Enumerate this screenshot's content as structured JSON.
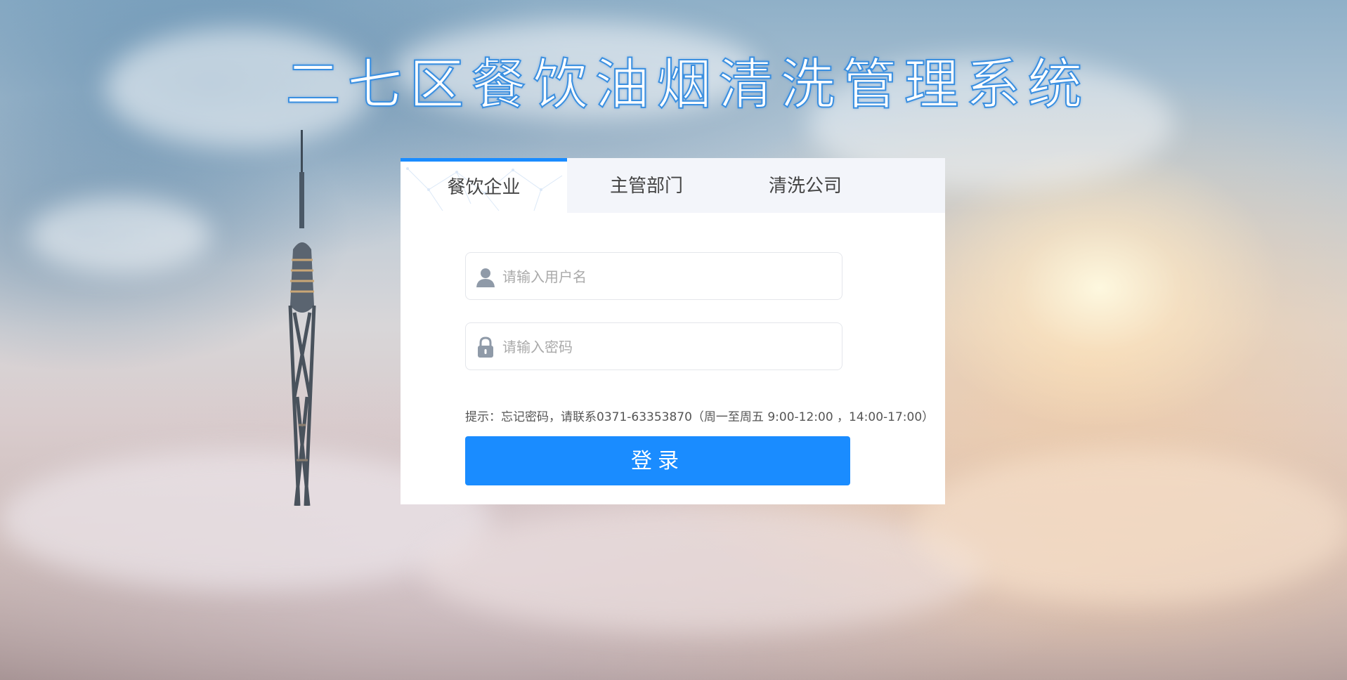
{
  "page": {
    "title": "二七区餐饮油烟清洗管理系统"
  },
  "tabs": [
    {
      "label": "餐饮企业",
      "active": true
    },
    {
      "label": "主管部门",
      "active": false
    },
    {
      "label": "清洗公司",
      "active": false
    }
  ],
  "form": {
    "username_placeholder": "请输入用户名",
    "username_value": "",
    "password_placeholder": "请输入密码",
    "password_value": "",
    "hint": "提示：忘记密码，请联系0371-63353870（周一至周五 9:00-12:00 ，14:00-17:00）",
    "login_label": "登录"
  },
  "icons": {
    "username": "user-icon",
    "password": "lock-icon"
  },
  "colors": {
    "accent": "#1a8cff",
    "title_stroke": "#3a8fe0",
    "tab_bar": "#f3f5fa"
  }
}
